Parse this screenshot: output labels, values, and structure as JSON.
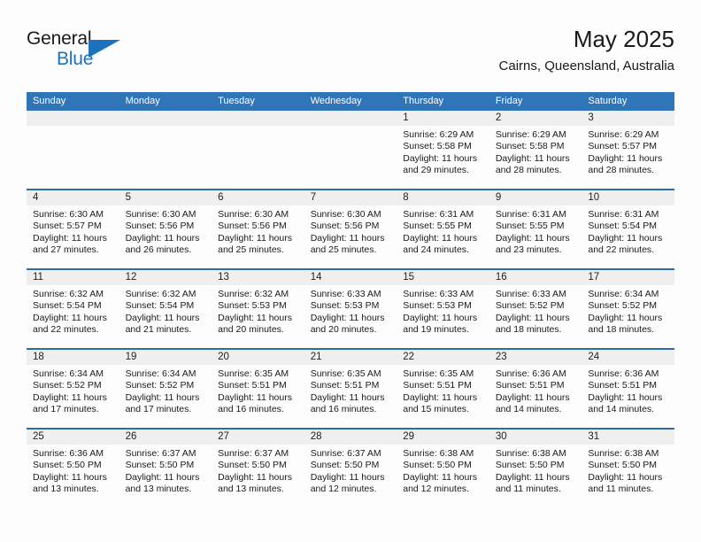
{
  "brand": {
    "line1": "General",
    "line2": "Blue",
    "triangle_color": "#1c72bd",
    "icon": "brand-triangle-icon"
  },
  "header": {
    "title": "May 2025",
    "subtitle": "Cairns, Queensland, Australia"
  },
  "colors": {
    "header_blue": "#3075b8",
    "row_divider_blue": "#2e6da4",
    "daynum_band": "#efefef",
    "brand_blue": "#1c72bd",
    "text": "#1a1a1a",
    "page_background": "#fdfdfd"
  },
  "weekday_headers": [
    "Sunday",
    "Monday",
    "Tuesday",
    "Wednesday",
    "Thursday",
    "Friday",
    "Saturday"
  ],
  "labels": {
    "sunrise_prefix": "Sunrise: ",
    "sunset_prefix": "Sunset: ",
    "daylight_prefix": "Daylight: "
  },
  "weeks": [
    [
      {
        "day": "",
        "sunrise": "",
        "sunset": "",
        "daylight_line1": "",
        "daylight_line2": "",
        "empty": true
      },
      {
        "day": "",
        "sunrise": "",
        "sunset": "",
        "daylight_line1": "",
        "daylight_line2": "",
        "empty": true
      },
      {
        "day": "",
        "sunrise": "",
        "sunset": "",
        "daylight_line1": "",
        "daylight_line2": "",
        "empty": true
      },
      {
        "day": "",
        "sunrise": "",
        "sunset": "",
        "daylight_line1": "",
        "daylight_line2": "",
        "empty": true
      },
      {
        "day": "1",
        "sunrise": "Sunrise: 6:29 AM",
        "sunset": "Sunset: 5:58 PM",
        "daylight_line1": "Daylight: 11 hours",
        "daylight_line2": "and 29 minutes.",
        "empty": false
      },
      {
        "day": "2",
        "sunrise": "Sunrise: 6:29 AM",
        "sunset": "Sunset: 5:58 PM",
        "daylight_line1": "Daylight: 11 hours",
        "daylight_line2": "and 28 minutes.",
        "empty": false
      },
      {
        "day": "3",
        "sunrise": "Sunrise: 6:29 AM",
        "sunset": "Sunset: 5:57 PM",
        "daylight_line1": "Daylight: 11 hours",
        "daylight_line2": "and 28 minutes.",
        "empty": false
      }
    ],
    [
      {
        "day": "4",
        "sunrise": "Sunrise: 6:30 AM",
        "sunset": "Sunset: 5:57 PM",
        "daylight_line1": "Daylight: 11 hours",
        "daylight_line2": "and 27 minutes.",
        "empty": false
      },
      {
        "day": "5",
        "sunrise": "Sunrise: 6:30 AM",
        "sunset": "Sunset: 5:56 PM",
        "daylight_line1": "Daylight: 11 hours",
        "daylight_line2": "and 26 minutes.",
        "empty": false
      },
      {
        "day": "6",
        "sunrise": "Sunrise: 6:30 AM",
        "sunset": "Sunset: 5:56 PM",
        "daylight_line1": "Daylight: 11 hours",
        "daylight_line2": "and 25 minutes.",
        "empty": false
      },
      {
        "day": "7",
        "sunrise": "Sunrise: 6:30 AM",
        "sunset": "Sunset: 5:56 PM",
        "daylight_line1": "Daylight: 11 hours",
        "daylight_line2": "and 25 minutes.",
        "empty": false
      },
      {
        "day": "8",
        "sunrise": "Sunrise: 6:31 AM",
        "sunset": "Sunset: 5:55 PM",
        "daylight_line1": "Daylight: 11 hours",
        "daylight_line2": "and 24 minutes.",
        "empty": false
      },
      {
        "day": "9",
        "sunrise": "Sunrise: 6:31 AM",
        "sunset": "Sunset: 5:55 PM",
        "daylight_line1": "Daylight: 11 hours",
        "daylight_line2": "and 23 minutes.",
        "empty": false
      },
      {
        "day": "10",
        "sunrise": "Sunrise: 6:31 AM",
        "sunset": "Sunset: 5:54 PM",
        "daylight_line1": "Daylight: 11 hours",
        "daylight_line2": "and 22 minutes.",
        "empty": false
      }
    ],
    [
      {
        "day": "11",
        "sunrise": "Sunrise: 6:32 AM",
        "sunset": "Sunset: 5:54 PM",
        "daylight_line1": "Daylight: 11 hours",
        "daylight_line2": "and 22 minutes.",
        "empty": false
      },
      {
        "day": "12",
        "sunrise": "Sunrise: 6:32 AM",
        "sunset": "Sunset: 5:54 PM",
        "daylight_line1": "Daylight: 11 hours",
        "daylight_line2": "and 21 minutes.",
        "empty": false
      },
      {
        "day": "13",
        "sunrise": "Sunrise: 6:32 AM",
        "sunset": "Sunset: 5:53 PM",
        "daylight_line1": "Daylight: 11 hours",
        "daylight_line2": "and 20 minutes.",
        "empty": false
      },
      {
        "day": "14",
        "sunrise": "Sunrise: 6:33 AM",
        "sunset": "Sunset: 5:53 PM",
        "daylight_line1": "Daylight: 11 hours",
        "daylight_line2": "and 20 minutes.",
        "empty": false
      },
      {
        "day": "15",
        "sunrise": "Sunrise: 6:33 AM",
        "sunset": "Sunset: 5:53 PM",
        "daylight_line1": "Daylight: 11 hours",
        "daylight_line2": "and 19 minutes.",
        "empty": false
      },
      {
        "day": "16",
        "sunrise": "Sunrise: 6:33 AM",
        "sunset": "Sunset: 5:52 PM",
        "daylight_line1": "Daylight: 11 hours",
        "daylight_line2": "and 18 minutes.",
        "empty": false
      },
      {
        "day": "17",
        "sunrise": "Sunrise: 6:34 AM",
        "sunset": "Sunset: 5:52 PM",
        "daylight_line1": "Daylight: 11 hours",
        "daylight_line2": "and 18 minutes.",
        "empty": false
      }
    ],
    [
      {
        "day": "18",
        "sunrise": "Sunrise: 6:34 AM",
        "sunset": "Sunset: 5:52 PM",
        "daylight_line1": "Daylight: 11 hours",
        "daylight_line2": "and 17 minutes.",
        "empty": false
      },
      {
        "day": "19",
        "sunrise": "Sunrise: 6:34 AM",
        "sunset": "Sunset: 5:52 PM",
        "daylight_line1": "Daylight: 11 hours",
        "daylight_line2": "and 17 minutes.",
        "empty": false
      },
      {
        "day": "20",
        "sunrise": "Sunrise: 6:35 AM",
        "sunset": "Sunset: 5:51 PM",
        "daylight_line1": "Daylight: 11 hours",
        "daylight_line2": "and 16 minutes.",
        "empty": false
      },
      {
        "day": "21",
        "sunrise": "Sunrise: 6:35 AM",
        "sunset": "Sunset: 5:51 PM",
        "daylight_line1": "Daylight: 11 hours",
        "daylight_line2": "and 16 minutes.",
        "empty": false
      },
      {
        "day": "22",
        "sunrise": "Sunrise: 6:35 AM",
        "sunset": "Sunset: 5:51 PM",
        "daylight_line1": "Daylight: 11 hours",
        "daylight_line2": "and 15 minutes.",
        "empty": false
      },
      {
        "day": "23",
        "sunrise": "Sunrise: 6:36 AM",
        "sunset": "Sunset: 5:51 PM",
        "daylight_line1": "Daylight: 11 hours",
        "daylight_line2": "and 14 minutes.",
        "empty": false
      },
      {
        "day": "24",
        "sunrise": "Sunrise: 6:36 AM",
        "sunset": "Sunset: 5:51 PM",
        "daylight_line1": "Daylight: 11 hours",
        "daylight_line2": "and 14 minutes.",
        "empty": false
      }
    ],
    [
      {
        "day": "25",
        "sunrise": "Sunrise: 6:36 AM",
        "sunset": "Sunset: 5:50 PM",
        "daylight_line1": "Daylight: 11 hours",
        "daylight_line2": "and 13 minutes.",
        "empty": false
      },
      {
        "day": "26",
        "sunrise": "Sunrise: 6:37 AM",
        "sunset": "Sunset: 5:50 PM",
        "daylight_line1": "Daylight: 11 hours",
        "daylight_line2": "and 13 minutes.",
        "empty": false
      },
      {
        "day": "27",
        "sunrise": "Sunrise: 6:37 AM",
        "sunset": "Sunset: 5:50 PM",
        "daylight_line1": "Daylight: 11 hours",
        "daylight_line2": "and 13 minutes.",
        "empty": false
      },
      {
        "day": "28",
        "sunrise": "Sunrise: 6:37 AM",
        "sunset": "Sunset: 5:50 PM",
        "daylight_line1": "Daylight: 11 hours",
        "daylight_line2": "and 12 minutes.",
        "empty": false
      },
      {
        "day": "29",
        "sunrise": "Sunrise: 6:38 AM",
        "sunset": "Sunset: 5:50 PM",
        "daylight_line1": "Daylight: 11 hours",
        "daylight_line2": "and 12 minutes.",
        "empty": false
      },
      {
        "day": "30",
        "sunrise": "Sunrise: 6:38 AM",
        "sunset": "Sunset: 5:50 PM",
        "daylight_line1": "Daylight: 11 hours",
        "daylight_line2": "and 11 minutes.",
        "empty": false
      },
      {
        "day": "31",
        "sunrise": "Sunrise: 6:38 AM",
        "sunset": "Sunset: 5:50 PM",
        "daylight_line1": "Daylight: 11 hours",
        "daylight_line2": "and 11 minutes.",
        "empty": false
      }
    ]
  ]
}
